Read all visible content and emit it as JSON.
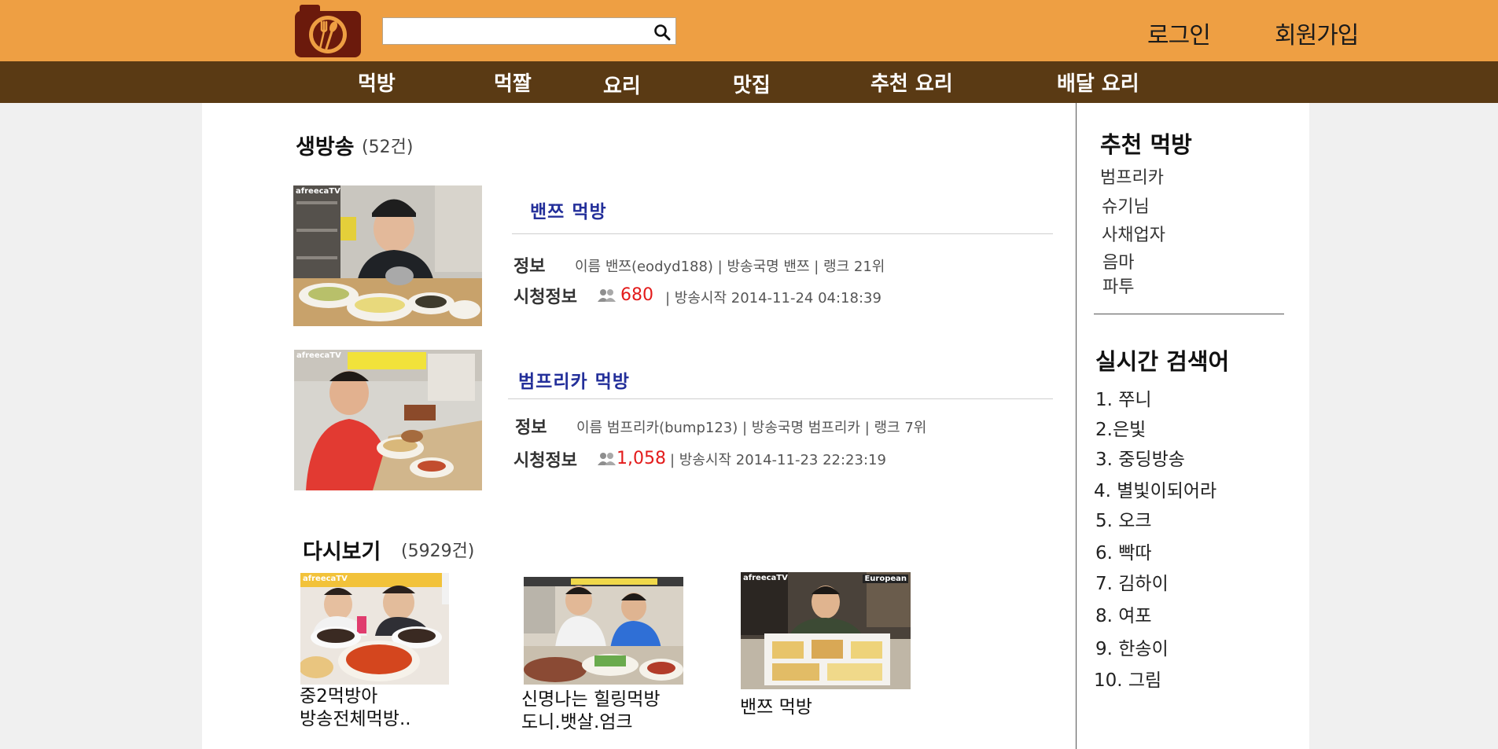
{
  "header": {
    "search": {
      "value": "",
      "placeholder": ""
    },
    "login_label": "로그인",
    "signup_label": "회원가입"
  },
  "nav": {
    "items": [
      "먹방",
      "먹짤",
      "요리",
      "맛집",
      "추천 요리",
      "배달 요리"
    ]
  },
  "live": {
    "title": "생방송",
    "count": "(52건)",
    "streams": [
      {
        "title": "밴쯔 먹방",
        "info_label": "정보",
        "info": "이름 밴쯔(eodyd188) | 방송국명 밴쯔 | 랭크 21위",
        "watch_label": "시청정보",
        "viewers": "680",
        "start": "| 방송시작 2014-11-24 04:18:39",
        "thumb_logo": "afreecaTV"
      },
      {
        "title": "범프리카 먹방",
        "info_label": "정보",
        "info": "이름 범프리카(bump123) | 방송국명 범프리카 | 랭크 7위",
        "watch_label": "시청정보",
        "viewers": "1,058",
        "start": "| 방송시작 2014-11-23 22:23:19",
        "thumb_logo": "afreecaTV"
      }
    ]
  },
  "replay": {
    "title": "다시보기",
    "count": "(5929건)",
    "items": [
      {
        "caption_line1": "중2먹방아",
        "caption_line2": "방송전체먹방..",
        "thumb_logo": "afreecaTV"
      },
      {
        "caption_line1": "신명나는 힐링먹방",
        "caption_line2": "도니.뱃살.엄크",
        "thumb_logo": ""
      },
      {
        "caption_line1": "밴쯔 먹방",
        "caption_line2": "",
        "thumb_logo": "afreecaTV",
        "badge": "European"
      }
    ]
  },
  "sidebar": {
    "recommend_title": "추천 먹방",
    "recommend": [
      "범프리카",
      "슈기님",
      "사채업자",
      "음마",
      "파투"
    ],
    "trending_title": "실시간 검색어",
    "trending": [
      "1. 쭈니",
      "2.은빛",
      "3. 중딩방송",
      "4. 별빛이되어라",
      "5. 오크",
      "6. 빡따",
      "7. 김하이",
      "8. 여포",
      "9. 한송이",
      "10. 그림"
    ]
  },
  "icons": {
    "logo": "camera-fork-spoon-logo",
    "search": "magnifier-icon",
    "viewers": "people-icon"
  },
  "colors": {
    "header_bg": "#ee9f43",
    "nav_bg": "#5a3a14",
    "logo_bg": "#6b1a0c",
    "stream_title": "#232f9a",
    "viewers": "#e31b1b"
  }
}
